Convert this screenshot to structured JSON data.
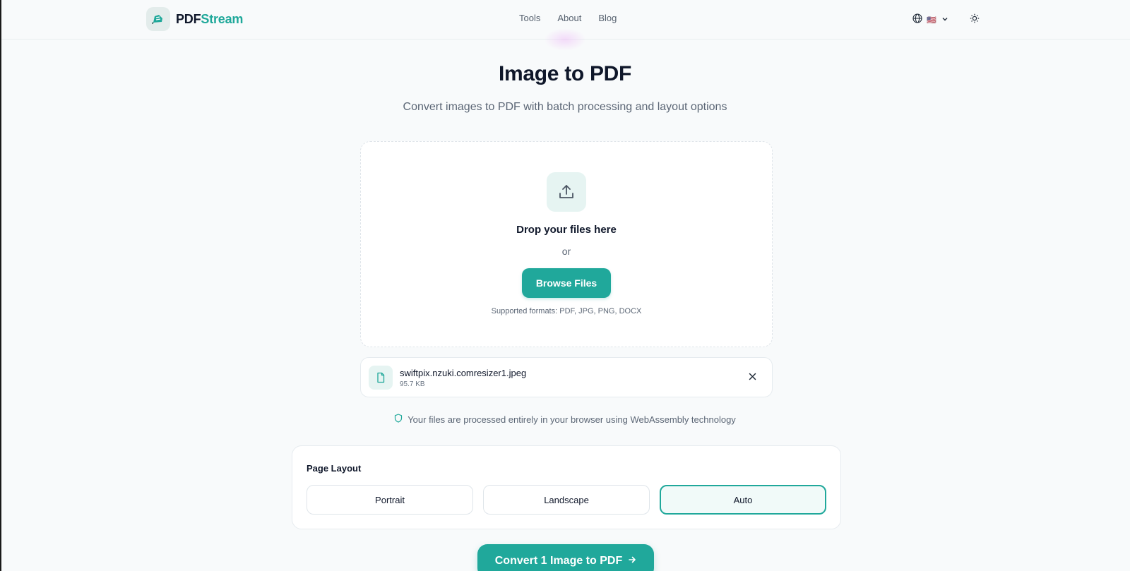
{
  "brand": {
    "part1": "PDF",
    "part2": "Stream",
    "accent": "#20a89b"
  },
  "nav": {
    "links": [
      "Tools",
      "About",
      "Blog"
    ]
  },
  "header_controls": {
    "language_icon": "globe-icon",
    "flag": "🇺🇸",
    "theme_icon": "sun-icon"
  },
  "hero": {
    "title": "Image to PDF",
    "subtitle": "Convert images to PDF with batch processing and layout options"
  },
  "dropzone": {
    "icon": "upload-icon",
    "title": "Drop your files here",
    "or": "or",
    "browse_label": "Browse Files",
    "formats": "Supported formats: PDF, JPG, PNG, DOCX"
  },
  "files": [
    {
      "name": "swiftpix.nzuki.comresizer1.jpeg",
      "size": "95.7 KB",
      "icon": "file-icon"
    }
  ],
  "privacy_text": "Your files are processed entirely in your browser using WebAssembly technology",
  "page_layout": {
    "label": "Page Layout",
    "options": [
      "Portrait",
      "Landscape",
      "Auto"
    ],
    "selected": "Auto"
  },
  "convert": {
    "label": "Convert 1 Image to PDF",
    "icon": "arrow-right-icon"
  }
}
